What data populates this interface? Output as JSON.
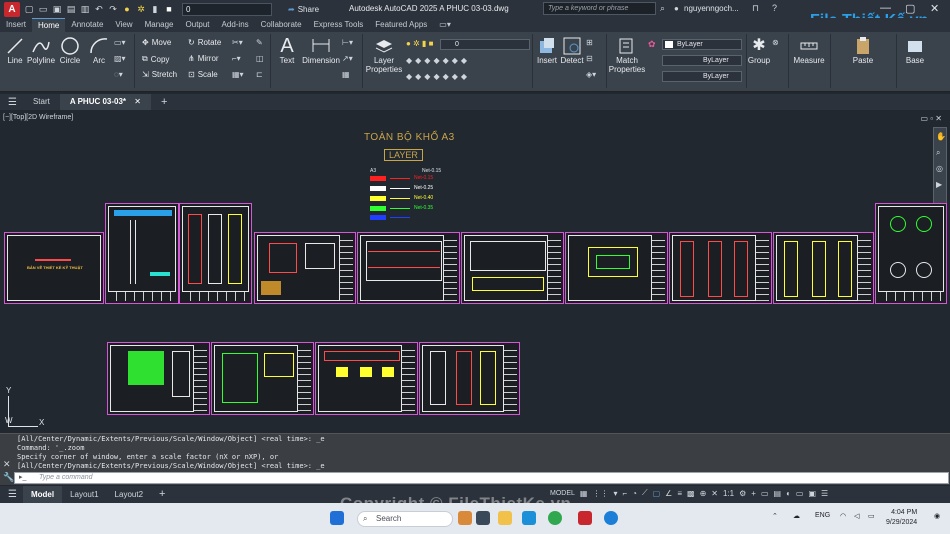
{
  "titlebar": {
    "app_letter": "A",
    "layer_value": "0",
    "share_label": "Share",
    "title": "Autodesk AutoCAD 2025    A PHUC 03-03.dwg",
    "search_placeholder": "Type a keyword or phrase",
    "user": "nguyenngoch...",
    "minimize": "—",
    "maximize": "▢",
    "close": "✕"
  },
  "ribbon_tabs": [
    "Insert",
    "Home",
    "Annotate",
    "View",
    "Manage",
    "Output",
    "Add-ins",
    "Collaborate",
    "Express Tools",
    "Featured Apps"
  ],
  "ribbon": {
    "line": "Line",
    "polyline": "Polyline",
    "circle": "Circle",
    "arc": "Arc",
    "move": "Move",
    "rotate": "Rotate",
    "copy": "Copy",
    "mirror": "Mirror",
    "stretch": "Stretch",
    "scale": "Scale",
    "text": "Text",
    "dimension": "Dimension",
    "layer_properties": "Layer Properties",
    "layer_combo": "0",
    "insert": "Insert",
    "detect": "Detect",
    "match_properties": "Match Properties",
    "bylayer_color": "ByLayer",
    "bylayer_line1": "ByLayer",
    "bylayer_line2": "ByLayer",
    "group": "Group",
    "measure": "Measure",
    "paste": "Paste",
    "base": "Base"
  },
  "file_tabs": {
    "start": "Start",
    "active": "A PHUC 03-03*",
    "add": "+"
  },
  "viewport": {
    "label": "[−][Top][2D Wireframe]",
    "heading": "TOÀN BỘ KHỔ A3",
    "layer_box": "LAYER",
    "legend_header_left": "A3",
    "legend_header_right": "Net-0.15",
    "legend": [
      {
        "color": "#ff2020",
        "label": "Net-0.15"
      },
      {
        "color": "#ffffff",
        "label": "Net-0.25"
      },
      {
        "color": "#ffff30",
        "label": "Net-0.40"
      },
      {
        "color": "#30ff30",
        "label": "Net-0.35"
      },
      {
        "color": "#2040ff",
        "label": ""
      }
    ],
    "cover_title": "BẢN VẼ THIẾT KẾ KỸ THUẬT",
    "axis_x": "X",
    "axis_y": "Y",
    "axis_w": "W",
    "view_tools": "▭  ▫  ✕"
  },
  "command": {
    "lines": [
      "[All/Center/Dynamic/Extents/Previous/Scale/Window/Object] <real time>: _e",
      "Command: '_.zoom",
      "Specify corner of window, enter a scale factor (nX or nXP), or",
      "[All/Center/Dynamic/Extents/Previous/Scale/Window/Object] <real time>: _e"
    ],
    "input_placeholder": "Type a command"
  },
  "status": {
    "tabs": [
      "Model",
      "Layout1",
      "Layout2"
    ],
    "add": "+",
    "model_label": "MODEL",
    "scale": "1:1"
  },
  "taskbar": {
    "search": "Search",
    "lang": "ENG",
    "time": "4:04 PM",
    "date": "9/29/2024"
  },
  "watermark": {
    "logo": "File Thiết Kế.vn",
    "copyright": "Copyright © FileThietKe.vn"
  },
  "colors": {
    "sheet_border": "#d657d6",
    "accent": "#5b9bd5",
    "heading": "#c9a54a"
  }
}
